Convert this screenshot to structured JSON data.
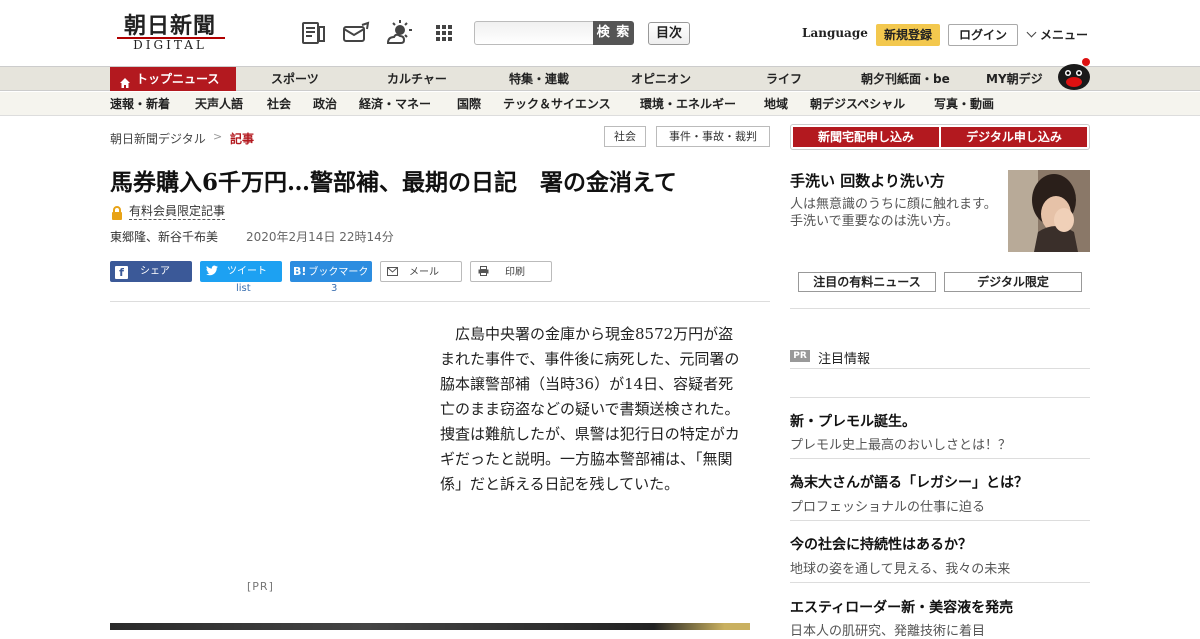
{
  "header": {
    "logo_title": "朝日新聞",
    "logo_subtitle": "DIGITAL",
    "icons": [
      "newspaper-icon",
      "mail-icon",
      "weather-icon",
      "apps-grid-icon"
    ],
    "search": {
      "placeholder": "",
      "button_label": "検 索"
    },
    "toc_label": "目次",
    "language_label": "Language",
    "register_label": "新規登録",
    "login_label": "ログイン",
    "menu_label": "メニュー"
  },
  "nav": {
    "primary": [
      "トップニュース",
      "スポーツ",
      "カルチャー",
      "特集・連載",
      "オピニオン",
      "ライフ",
      "朝夕刊紙面・be",
      "MY朝デジ"
    ],
    "secondary": [
      "速報・新着",
      "天声人語",
      "社会",
      "政治",
      "経済・マネー",
      "国際",
      "テック＆サイエンス",
      "環境・エネルギー",
      "地域",
      "朝デジスペシャル",
      "写真・動画"
    ]
  },
  "breadcrumb": {
    "home": "朝日新聞デジタル",
    "separator": ">",
    "current": "記事"
  },
  "tags": [
    "社会",
    "事件・事故・裁判"
  ],
  "article": {
    "headline": "馬券購入6千万円…警部補、最期の日記　署の金消えて",
    "members_badge": "有料会員限定記事",
    "byline": "東郷隆、新谷千布美",
    "timestamp": "2020年2月14日 22時14分",
    "share": {
      "facebook": "シェア",
      "twitter": "ツイート",
      "twitter_count": "list",
      "hatena": "ブックマーク",
      "hatena_count": "3",
      "mail": "メール",
      "print": "印刷"
    },
    "body": "広島中央署の金庫から現金8572万円が盗まれた事件で、事件後に病死した、元同署の脇本譲警部補（当時36）が14日、容疑者死亡のまま窃盗などの疑いで書類送検された。捜査は難航したが、県警は犯行日の特定がカギだったと説明。一方脇本警部補は、「無関係」だと訴える日記を残していた。",
    "pr_label": "[PR]"
  },
  "sidebar": {
    "subscribe_paper": "新聞宅配申し込み",
    "subscribe_digital": "デジタル申し込み",
    "promo": {
      "title": "手洗い 回数より洗い方",
      "description": "人は無意識のうちに顔に触れます。手洗いで重要なのは洗い方。"
    },
    "featured_paid": "注目の有料ニュース",
    "digital_only": "デジタル限定",
    "pr_badge": "PR",
    "featured_heading": "注目情報",
    "pr_items": [
      {
        "title": "新・プレモル誕生。",
        "desc": "プレモル史上最高のおいしさとは！？"
      },
      {
        "title": "為末大さんが語る「レガシー」とは？",
        "desc": "プロフェッショナルの仕事に迫る"
      },
      {
        "title": "今の社会に持続性はあるか？",
        "desc": "地球の姿を通して見える、我々の未来"
      },
      {
        "title": "エスティローダー新・美容液を発売",
        "desc": "日本人の肌研究、発離技術に着目"
      }
    ]
  },
  "colors": {
    "brand_red": "#b3191f",
    "register_yellow": "#f3c84e",
    "nav_bg": "#e6e4dc"
  }
}
